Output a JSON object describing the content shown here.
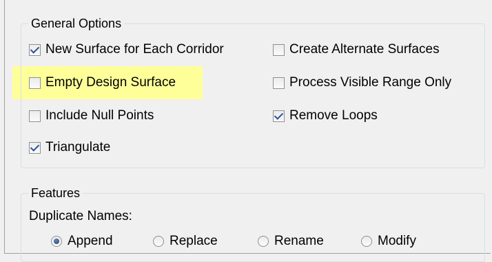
{
  "general_options": {
    "title": "General Options",
    "options": [
      {
        "id": "new-surface",
        "label": "New Surface for Each Corridor",
        "checked": true
      },
      {
        "id": "create-alternate",
        "label": "Create Alternate Surfaces",
        "checked": false
      },
      {
        "id": "empty-design",
        "label": "Empty Design Surface",
        "checked": false,
        "highlighted": true
      },
      {
        "id": "process-visible",
        "label": "Process Visible Range Only",
        "checked": false
      },
      {
        "id": "include-null",
        "label": "Include Null Points",
        "checked": false
      },
      {
        "id": "remove-loops",
        "label": "Remove Loops",
        "checked": true
      },
      {
        "id": "triangulate",
        "label": "Triangulate",
        "checked": true
      }
    ]
  },
  "features": {
    "title": "Features",
    "duplicate_names_label": "Duplicate Names:",
    "radios": [
      {
        "id": "append",
        "label": "Append",
        "selected": true
      },
      {
        "id": "replace",
        "label": "Replace",
        "selected": false
      },
      {
        "id": "rename",
        "label": "Rename",
        "selected": false
      },
      {
        "id": "modify",
        "label": "Modify",
        "selected": false
      }
    ]
  },
  "colors": {
    "highlight": "#ffff9a",
    "check": "#2b4f9c"
  }
}
